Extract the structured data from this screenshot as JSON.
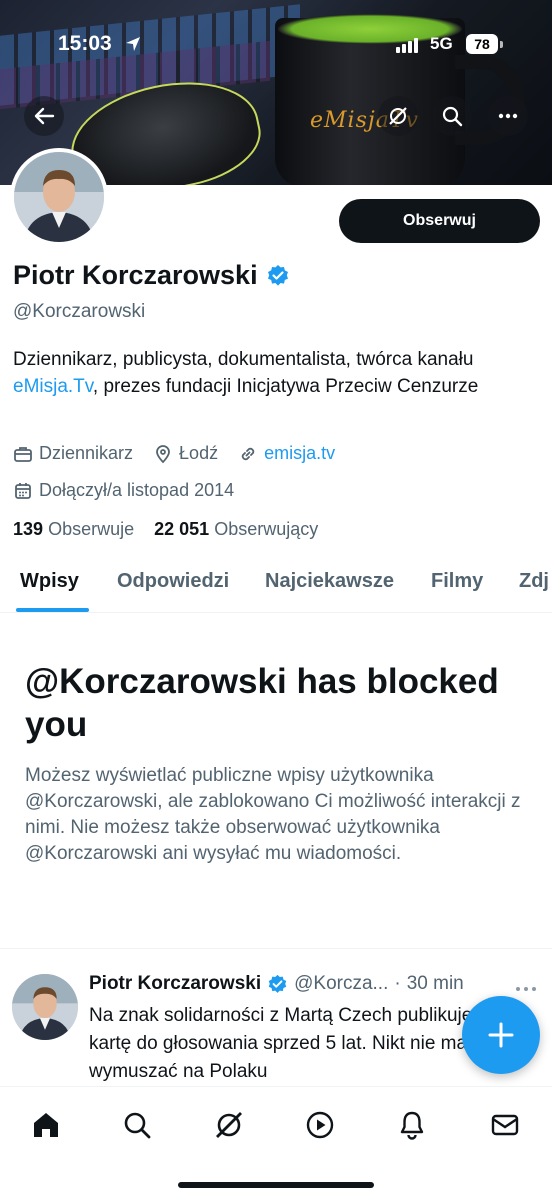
{
  "status_bar": {
    "time": "15:03",
    "network": "5G",
    "battery": "78"
  },
  "profile": {
    "name": "Piotr Korczarowski",
    "handle": "@Korczarowski",
    "follow_label": "Obserwuj",
    "bio_part1": "Dziennikarz, publicysta, dokumentalista, twórca kanału ",
    "bio_link": "eMisja.Tv",
    "bio_part2": ", prezes fundacji Inicjatywa Przeciw Cenzurze",
    "profession": "Dziennikarz",
    "location": "Łodź",
    "website": "emisja.tv",
    "joined": "Dołączył/a listopad 2014",
    "following_count": "139",
    "following_label": "Obserwuje",
    "followers_count": "22 051",
    "followers_label": "Obserwujący",
    "banner_logo": "eMisjaTv"
  },
  "tabs": [
    "Wpisy",
    "Odpowiedzi",
    "Najciekawsze",
    "Filmy",
    "Zdj"
  ],
  "blocked": {
    "title": "@Korczarowski has blocked you",
    "body": "Możesz wyświetlać publiczne wpisy użytkownika @Korczarowski, ale zablokowano Ci możliwość interakcji z nimi. Nie możesz także obserwować użytkownika @Korczarowski ani wysyłać mu wiadomości."
  },
  "tweet": {
    "author": "Piotr Korczarowski",
    "handle": "@Korcza...",
    "sep": "·",
    "time": "30 min",
    "text": "Na znak solidarności z Martą Czech publikuję moją kartę do głosowania sprzed 5 lat. Nikt nie ma prawa wymuszać na Polaku"
  },
  "colors": {
    "accent": "#1d9bf0",
    "text": "#0f1419",
    "muted": "#536471"
  },
  "icons": {
    "back": "arrow-left-icon",
    "grok": "grok-icon",
    "search": "search-icon",
    "more": "more-icon",
    "verified": "verified-badge-icon",
    "briefcase": "briefcase-icon",
    "location": "location-pin-icon",
    "link": "link-icon",
    "calendar": "calendar-icon",
    "compose": "plus-icon",
    "nav": [
      "home-icon",
      "search-icon",
      "grok-icon",
      "play-icon",
      "bell-icon",
      "mail-icon"
    ]
  }
}
